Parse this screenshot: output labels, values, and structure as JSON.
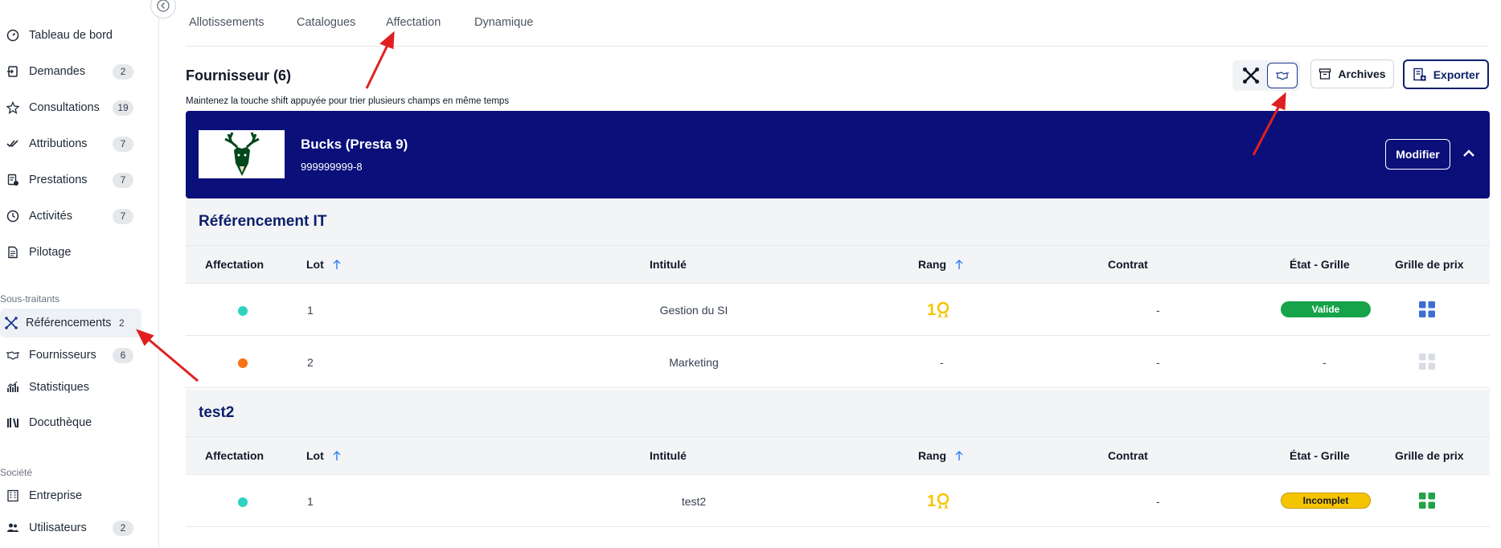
{
  "sidebar": {
    "items": [
      {
        "label": "Tableau de bord",
        "icon": "gauge-icon",
        "badge": ""
      },
      {
        "label": "Demandes",
        "icon": "inbox-icon",
        "badge": "2"
      },
      {
        "label": "Consultations",
        "icon": "star-icon",
        "badge": "19"
      },
      {
        "label": "Attributions",
        "icon": "double-check-icon",
        "badge": "7"
      },
      {
        "label": "Prestations",
        "icon": "document-gear-icon",
        "badge": "7"
      },
      {
        "label": "Activités",
        "icon": "clock-icon",
        "badge": "7"
      },
      {
        "label": "Pilotage",
        "icon": "document-icon",
        "badge": ""
      }
    ],
    "section_subcontractors": "Sous-traitants",
    "subcontractor_items": [
      {
        "label": "Référencements",
        "icon": "network-icon",
        "badge": "2",
        "active": true
      },
      {
        "label": "Fournisseurs",
        "icon": "handshake-icon",
        "badge": "6"
      },
      {
        "label": "Statistiques",
        "icon": "chart-icon",
        "badge": ""
      },
      {
        "label": "Docuthèque",
        "icon": "books-icon",
        "badge": ""
      }
    ],
    "section_company": "Société",
    "company_items": [
      {
        "label": "Entreprise",
        "icon": "building-icon",
        "badge": ""
      },
      {
        "label": "Utilisateurs",
        "icon": "users-icon",
        "badge": "2"
      }
    ]
  },
  "tabs": [
    "Allotissements",
    "Catalogues",
    "Affectation",
    "Dynamique"
  ],
  "page": {
    "title": "Fournisseur (6)",
    "hint": "Maintenez la touche shift appuyée pour trier plusieurs champs en même temps"
  },
  "toolbar": {
    "archives_label": "Archives",
    "export_label": "Exporter"
  },
  "supplier": {
    "name": "Bucks (Presta 9)",
    "id": "999999999-8",
    "modify_label": "Modifier"
  },
  "columns": [
    "Affectation",
    "Lot",
    "Intitulé",
    "Rang",
    "Contrat",
    "État - Grille",
    "Grille de prix"
  ],
  "groups": [
    {
      "title": "Référencement IT",
      "rows": [
        {
          "dot_color": "#2dd4bf",
          "lot": "1",
          "intitule": "Gestion du SI",
          "rang": "1",
          "contrat": "-",
          "etat": "Valide",
          "etat_color": "#16a34a",
          "grid_color": "#3b6fd4"
        },
        {
          "dot_color": "#f97316",
          "lot": "2",
          "intitule": "Marketing",
          "rang": "-",
          "contrat": "-",
          "etat": "-",
          "etat_color": "",
          "grid_color": "#d9dce3"
        }
      ]
    },
    {
      "title": "test2",
      "rows": [
        {
          "dot_color": "#2dd4bf",
          "lot": "1",
          "intitule": "test2",
          "rang": "1",
          "contrat": "-",
          "etat": "Incomplet",
          "etat_color": "#f5c400",
          "grid_color": "#22a347"
        }
      ]
    }
  ]
}
